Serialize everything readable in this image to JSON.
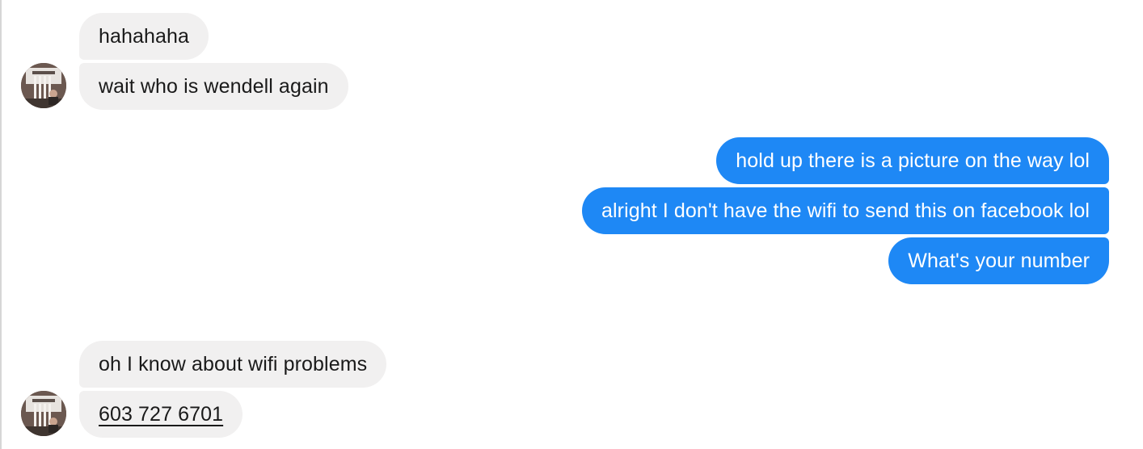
{
  "conversation": {
    "messages": [
      {
        "sender": "them",
        "text": "hahahaha"
      },
      {
        "sender": "them",
        "text": "wait who is wendell again"
      },
      {
        "sender": "me",
        "text": "hold up there is a picture on the way lol"
      },
      {
        "sender": "me",
        "text": "alright I don't have the wifi to send this on facebook lol"
      },
      {
        "sender": "me",
        "text": "What's your number"
      },
      {
        "sender": "them",
        "text": "oh I know about wifi problems"
      },
      {
        "sender": "them",
        "text": "603 727 6701",
        "is_link": true
      }
    ]
  },
  "colors": {
    "incoming_bubble": "#f1f0f0",
    "outgoing_bubble": "#1e88f5",
    "incoming_text": "#1a1a1a",
    "outgoing_text": "#ffffff"
  },
  "icons": {
    "avatar": "contact-photo-avatar"
  }
}
